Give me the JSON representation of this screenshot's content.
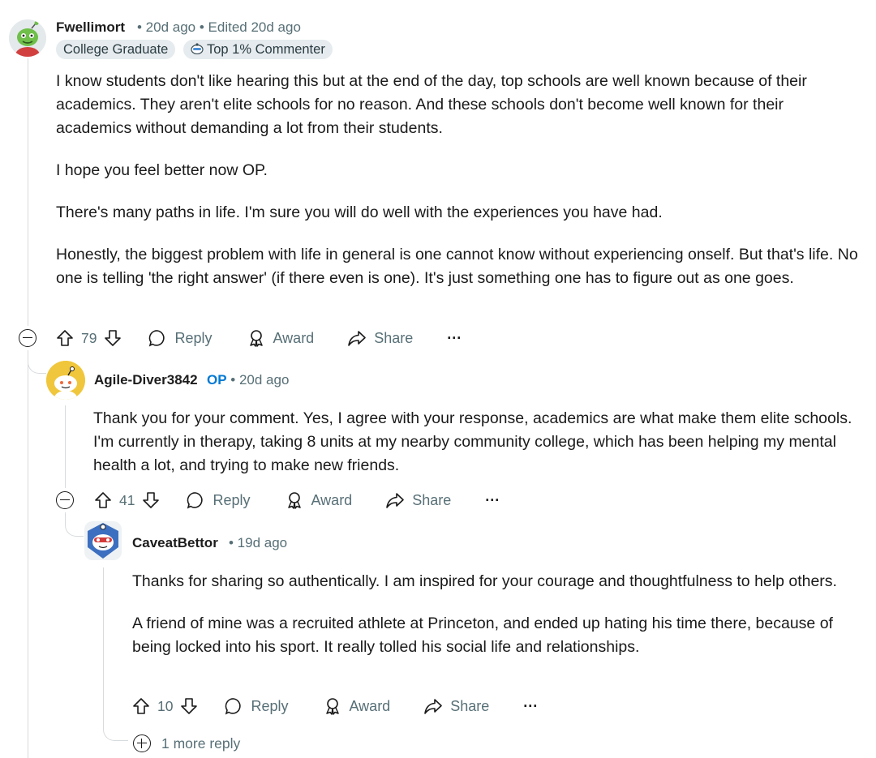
{
  "comments": [
    {
      "author": "Fwellimort",
      "meta": "• 20d ago • Edited 20d ago",
      "flairs": [
        {
          "label": "College Graduate",
          "icon": ""
        },
        {
          "label": "Top 1% Commenter",
          "icon": "top-commenter-icon"
        }
      ],
      "paragraphs": [
        "I know students don't like hearing this but at the end of the day, top schools are well known because of their academics. They aren't elite schools for no reason. And these schools don't become well known for their academics without demanding a lot from their students.",
        "I hope you feel better now OP.",
        "There's many paths in life. I'm sure you will do well with the experiences you have had.",
        "Honestly, the biggest problem with life in general is one cannot know without experiencing onself. But that's life. No one is telling 'the right answer' (if there even is one). It's just something one has to figure out as one goes."
      ],
      "votes": "79",
      "reply_label": "Reply",
      "award_label": "Award",
      "share_label": "Share",
      "more_label": "···"
    },
    {
      "author": "Agile-Diver3842",
      "op_label": "OP",
      "meta": "• 20d ago",
      "paragraphs": [
        "Thank you for your comment. Yes, I agree with your response, academics are what make them elite schools. I'm currently in therapy, taking 8 units at my nearby community college, which has been helping my mental health a lot, and trying to make new friends."
      ],
      "votes": "41",
      "reply_label": "Reply",
      "award_label": "Award",
      "share_label": "Share",
      "more_label": "···"
    },
    {
      "author": "CaveatBettor",
      "meta": "• 19d ago",
      "paragraphs": [
        "Thanks for sharing so authentically. I am inspired for your courage and thoughtfulness to help others.",
        "A friend of mine was a recruited athlete at Princeton, and ended up hating his time there, because of being locked into his sport. It really tolled his social life and relationships."
      ],
      "votes": "10",
      "reply_label": "Reply",
      "award_label": "Award",
      "share_label": "Share",
      "more_label": "···",
      "more_replies": "1 more reply"
    }
  ],
  "colors": {
    "text": "#1a1a1b",
    "meta": "#576f76",
    "op": "#0079d3",
    "flair_bg": "#e5ebee",
    "thread_line": "#d7dbdd"
  }
}
